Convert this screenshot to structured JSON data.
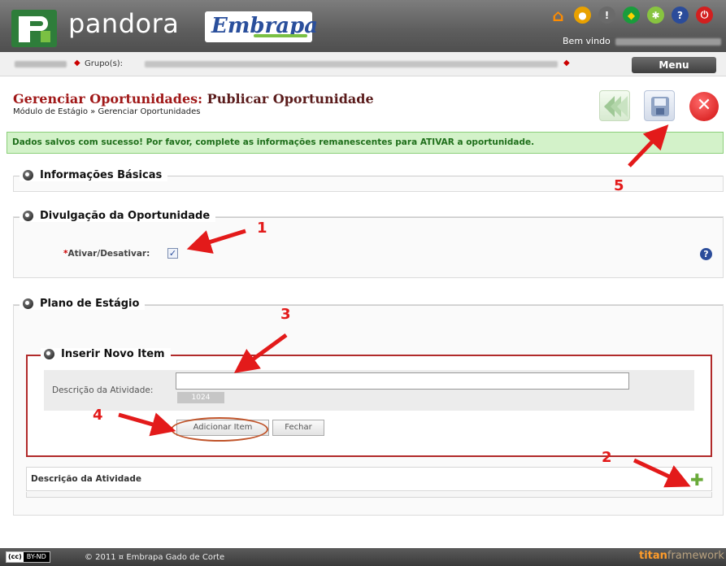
{
  "header": {
    "app_name": "pandora",
    "brand": "Embrapa",
    "welcome": "Bem vindo"
  },
  "breadcrumb": {
    "group_label": "Grupo(s):"
  },
  "menu_label": "Menu",
  "page": {
    "title_part1": "Gerenciar Oportunidades:",
    "title_part2": "Publicar Oportunidade",
    "trail": "Módulo de Estágio » Gerenciar Oportunidades"
  },
  "message": {
    "success": "Dados salvos com sucesso! Por favor, complete as informações remanescentes para ATIVAR a oportunidade."
  },
  "sections": {
    "basic": "Informações Básicas",
    "publicity": "Divulgação da Oportunidade",
    "plan": "Plano de Estágio",
    "new_item": "Inserir Novo Item"
  },
  "fields": {
    "activate_label": "Ativar/Desativar:",
    "activate_required": "*",
    "activate_checked": true,
    "description_label": "Descrição da Atividade:",
    "description_value": "",
    "char_counter": "1024"
  },
  "buttons": {
    "add_item": "Adicionar Item",
    "close": "Fechar"
  },
  "table": {
    "column": "Descrição da Atividade"
  },
  "annotations": [
    "1",
    "2",
    "3",
    "4",
    "5"
  ],
  "footer": {
    "cc_badge_left": "(cc)",
    "cc_badge_right": "BY-ND",
    "copyright": "© 2011 ¤ Embrapa Gado de Corte",
    "framework_a": "titan",
    "framework_b": "framework"
  },
  "colors": {
    "annotation_red": "#e31a1a",
    "title_red": "#a01818",
    "success_bg": "#d3f2c9",
    "header_gray": "#5d5d5d"
  }
}
